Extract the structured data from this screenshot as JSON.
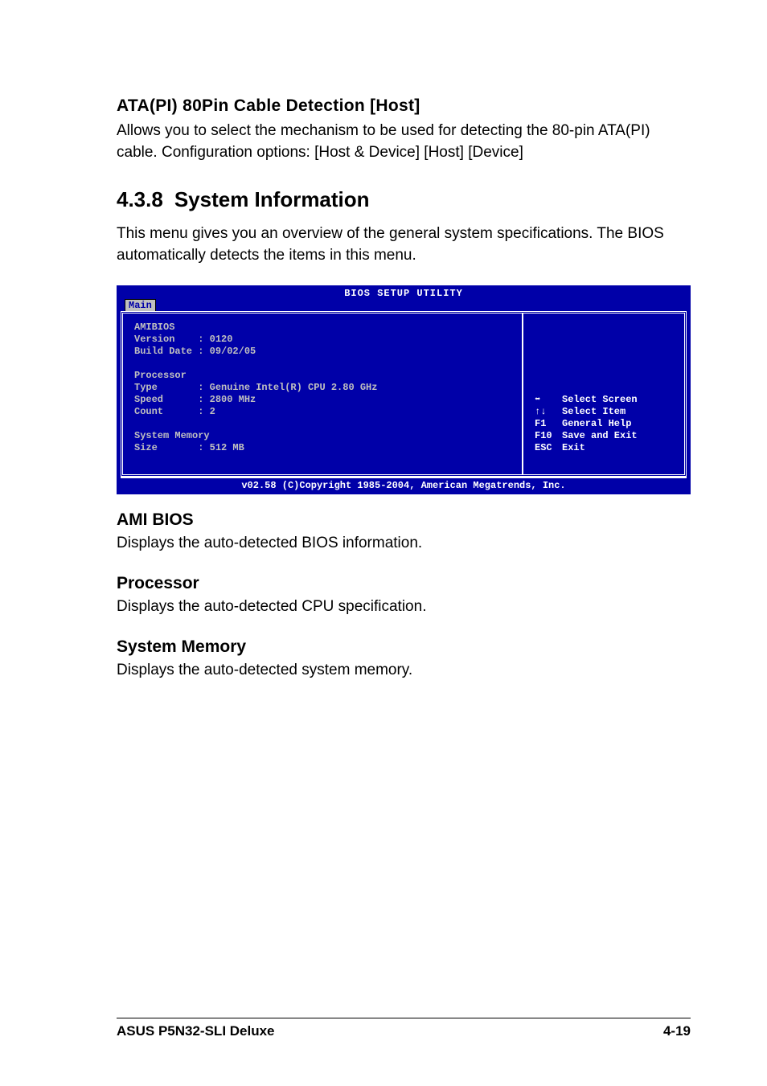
{
  "item1": {
    "title": "ATA(PI) 80Pin Cable Detection [Host]",
    "desc": "Allows you to select the mechanism to be used for detecting the 80-pin ATA(PI) cable. Configuration options: [Host & Device] [Host] [Device]"
  },
  "section": {
    "number": "4.3.8",
    "title": "System Information",
    "intro": "This menu gives you an overview of the general system specifications. The BIOS automatically detects the items in this menu."
  },
  "bios": {
    "title": "BIOS SETUP UTILITY",
    "tab": "Main",
    "amibios_label": "AMIBIOS",
    "version_line": "Version    : 0120",
    "build_line": "Build Date : 09/02/05",
    "processor_label": "Processor",
    "type_line": "Type       : Genuine Intel(R) CPU 2.80 GHz",
    "speed_line": "Speed      : 2800 MHz",
    "count_line": "Count      : 2",
    "sysmem_label": "System Memory",
    "size_line": "Size       : 512 MB",
    "help": {
      "l1_key": "⬌",
      "l1_txt": "Select Screen",
      "l2_key": "↑↓",
      "l2_txt": "Select Item",
      "l3_key": "F1",
      "l3_txt": "General Help",
      "l4_key": "F10",
      "l4_txt": "Save and Exit",
      "l5_key": "ESC",
      "l5_txt": "Exit"
    },
    "footer": "v02.58 (C)Copyright 1985-2004, American Megatrends, Inc."
  },
  "sub": {
    "amibios_h": "AMI BIOS",
    "amibios_t": "Displays the auto-detected BIOS information.",
    "proc_h": "Processor",
    "proc_t": "Displays the auto-detected CPU specification.",
    "mem_h": "System Memory",
    "mem_t": "Displays the auto-detected system memory."
  },
  "footer": {
    "left": "ASUS P5N32-SLI Deluxe",
    "right": "4-19"
  }
}
